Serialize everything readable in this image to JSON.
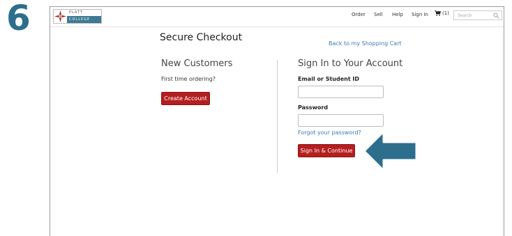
{
  "step": {
    "number": "6"
  },
  "brand": {
    "name_top": "PLATT",
    "name_bottom": "COLLEGE",
    "primary_color": "#3d7a93",
    "accent_color": "#b41f1f"
  },
  "nav": {
    "order": "Order",
    "sell": "Sell",
    "help": "Help",
    "sign_in": "Sign In",
    "cart_count": "(1)",
    "search_placeholder": "Search"
  },
  "page": {
    "title": "Secure Checkout",
    "back_link": "Back to my Shopping Cart"
  },
  "new_customers": {
    "heading": "New Customers",
    "subtext": "First time ordering?",
    "button": "Create Account"
  },
  "sign_in": {
    "heading": "Sign In to Your Account",
    "email_label": "Email or Student ID",
    "email_value": "",
    "password_label": "Password",
    "password_value": "",
    "forgot_link": "Forgot your password?",
    "button": "Sign In & Continue"
  },
  "annotation": {
    "arrow_color": "#2c6e8c",
    "icon": "left-arrow-icon"
  }
}
